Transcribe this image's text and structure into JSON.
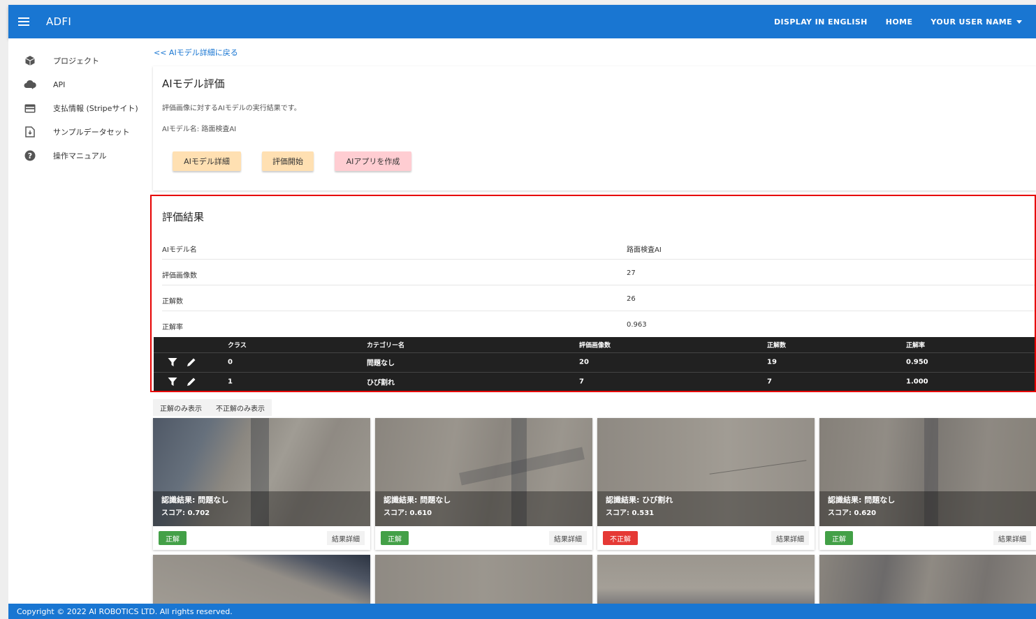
{
  "appbar": {
    "brand": "ADFI",
    "display_english": "DISPLAY IN ENGLISH",
    "home": "HOME",
    "user": "YOUR USER NAME"
  },
  "sidebar": {
    "items": [
      {
        "label": "プロジェクト",
        "icon": "cube-icon"
      },
      {
        "label": "API",
        "icon": "cloud-api-icon"
      },
      {
        "label": "支払情報 (Stripeサイト)",
        "icon": "credit-card-icon"
      },
      {
        "label": "サンプルデータセット",
        "icon": "file-download-icon"
      },
      {
        "label": "操作マニュアル",
        "icon": "help-icon"
      }
    ]
  },
  "back_link": "<< AIモデル詳細に戻る",
  "model_card": {
    "title": "AIモデル評価",
    "description": "評価画像に対するAIモデルの実行結果です。",
    "model_name_line": "AIモデル名: 路面検査AI",
    "buttons": [
      "AIモデル詳細",
      "評価開始",
      "AIアプリを作成"
    ]
  },
  "results": {
    "title": "評価結果",
    "rows": [
      {
        "key": "AIモデル名",
        "value": "路面検査AI"
      },
      {
        "key": "評価画像数",
        "value": "27"
      },
      {
        "key": "正解数",
        "value": "26"
      },
      {
        "key": "正解率",
        "value": "0.963"
      }
    ],
    "table": {
      "headers": [
        "クラス",
        "カテゴリー名",
        "評価画像数",
        "正解数",
        "正解率"
      ],
      "rows": [
        [
          "0",
          "問題なし",
          "20",
          "19",
          "0.950"
        ],
        [
          "1",
          "ひび割れ",
          "7",
          "7",
          "1.000"
        ]
      ]
    }
  },
  "filters": [
    "正解のみ表示",
    "不正解のみ表示"
  ],
  "images": [
    {
      "result": "認識結果: 問題なし",
      "score": "スコア: 0.702",
      "badge": "正解",
      "status": "ok",
      "detail": "結果詳細"
    },
    {
      "result": "認識結果: 問題なし",
      "score": "スコア: 0.610",
      "badge": "正解",
      "status": "ok",
      "detail": "結果詳細"
    },
    {
      "result": "認識結果: ひび割れ",
      "score": "スコア: 0.531",
      "badge": "不正解",
      "status": "ng",
      "detail": "結果詳細"
    },
    {
      "result": "認識結果: 問題なし",
      "score": "スコア: 0.620",
      "badge": "正解",
      "status": "ok",
      "detail": "結果詳細"
    }
  ],
  "footer": "Copyright © 2022 AI ROBOTICS LTD. All rights reserved.",
  "colors": {
    "primary": "#1976d2",
    "highlight_border": "#e60000",
    "ok": "#43a047",
    "ng": "#e53935"
  }
}
